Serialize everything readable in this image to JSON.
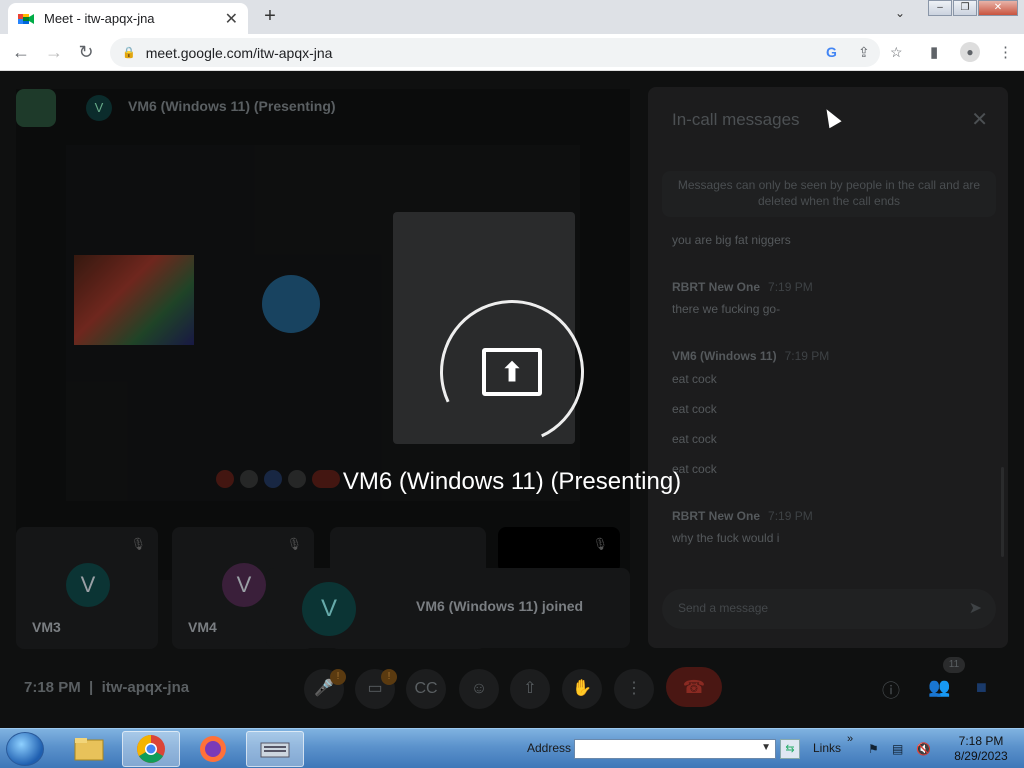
{
  "browser": {
    "tab_title": "Meet - itw-apqx-jna",
    "url": "meet.google.com/itw-apqx-jna"
  },
  "meet": {
    "presenter_initial": "V",
    "presenter_name": "VM6 (Windows 11) (Presenting)",
    "participants": [
      {
        "initial": "V",
        "name": "VM3",
        "color": "#0b3434"
      },
      {
        "initial": "V",
        "name": "VM4",
        "color": "#3a1f3a"
      }
    ],
    "toast": {
      "initial": "V",
      "text": "VM6 (Windows 11) joined"
    },
    "time": "7:18 PM",
    "meeting_code": "itw-apqx-jna",
    "participant_count": "11",
    "badges": [
      "!",
      "!"
    ]
  },
  "panel": {
    "title": "In-call messages",
    "note": "Messages can only be seen by people in the call and are deleted when the call ends",
    "messages": [
      {
        "type": "text",
        "text": "you are big fat niggers"
      },
      {
        "type": "sender",
        "name": "RBRT New One",
        "time": "7:19 PM"
      },
      {
        "type": "text",
        "text": "there we fucking go-"
      },
      {
        "type": "sender",
        "name": "VM6 (Windows 11)",
        "time": "7:19 PM"
      },
      {
        "type": "text",
        "text": "eat cock"
      },
      {
        "type": "text",
        "text": "eat cock"
      },
      {
        "type": "text",
        "text": "eat cock"
      },
      {
        "type": "text",
        "text": "eat cock"
      },
      {
        "type": "sender",
        "name": "RBRT New One",
        "time": "7:19 PM"
      },
      {
        "type": "text",
        "text": "why the fuck would i"
      }
    ],
    "send_placeholder": "Send a message"
  },
  "overlay": {
    "label": "VM6 (Windows 11) (Presenting)"
  },
  "taskbar": {
    "address_label": "Address",
    "links_label": "Links",
    "clock_time": "7:18 PM",
    "clock_date": "8/29/2023"
  },
  "colors": {
    "hangup": "#ea4335",
    "accent": "#1a73e8"
  }
}
